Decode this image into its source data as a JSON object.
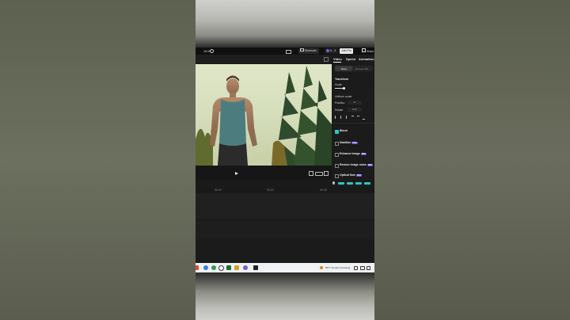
{
  "topbar": {
    "ratio": "16:9",
    "shortcuts_label": "Shortcuts",
    "user_label": "K...3",
    "upgrade_label": "Join Pro",
    "share_label": "Share"
  },
  "panel": {
    "tabs": [
      "Video",
      "Speed",
      "Animation"
    ],
    "segments": [
      "Basic",
      "Remove BG"
    ],
    "transform_label": "Transform",
    "scale_label": "Scale",
    "uniform_scale_label": "Uniform scale",
    "position_label": "Position",
    "position_value": "0",
    "rotate_label": "Rotate",
    "rotate_value": "0.0°",
    "blend_label": "Blend",
    "stabilize_label": "Stabilize",
    "enhance_label": "Enhance image",
    "reduce_noise_label": "Reduce image noise",
    "optical_label": "Optical flow",
    "badge_label": "PRO"
  },
  "timeline": {
    "ticks": [
      "00:10",
      "00:20",
      "00:30"
    ]
  },
  "taskbar": {
    "weather": "85°F  Clouds Increasing"
  },
  "colors": {
    "accent": "#2cc6c6",
    "pro_badge": "#6b47d6",
    "panel_bg": "#1b1b1b",
    "video_sky": "#dfe6c8"
  },
  "icons": [
    "play-icon",
    "fullscreen-icon",
    "ratio-icon",
    "settings-icon",
    "search-icon",
    "windows-icon"
  ]
}
